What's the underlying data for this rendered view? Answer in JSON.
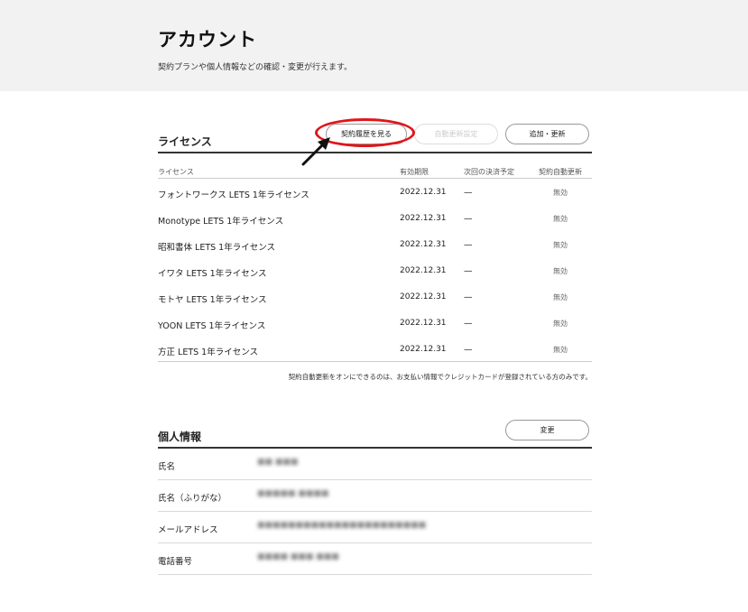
{
  "header": {
    "title": "アカウント",
    "description": "契約プランや個人情報などの確認・変更が行えます。"
  },
  "license_section": {
    "title": "ライセンス",
    "buttons": {
      "history": "契約履歴を見る",
      "auto_renew": "自動更新設定",
      "add_update": "追加・更新"
    },
    "columns": {
      "license": "ライセンス",
      "expiry": "有効期限",
      "next_payment": "次回の決済予定",
      "auto_renew": "契約自動更新"
    },
    "rows": [
      {
        "name": "フォントワークス LETS 1年ライセンス",
        "expiry": "2022.12.31",
        "next": "—",
        "auto": "無効"
      },
      {
        "name": "Monotype LETS 1年ライセンス",
        "expiry": "2022.12.31",
        "next": "—",
        "auto": "無効"
      },
      {
        "name": "昭和書体 LETS 1年ライセンス",
        "expiry": "2022.12.31",
        "next": "—",
        "auto": "無効"
      },
      {
        "name": "イワタ LETS 1年ライセンス",
        "expiry": "2022.12.31",
        "next": "—",
        "auto": "無効"
      },
      {
        "name": "モトヤ LETS 1年ライセンス",
        "expiry": "2022.12.31",
        "next": "—",
        "auto": "無効"
      },
      {
        "name": "YOON LETS 1年ライセンス",
        "expiry": "2022.12.31",
        "next": "—",
        "auto": "無効"
      },
      {
        "name": "方正 LETS 1年ライセンス",
        "expiry": "2022.12.31",
        "next": "—",
        "auto": "無効"
      }
    ],
    "note": "契約自動更新をオンにできるのは、お支払い情報でクレジットカードが登録されている方のみです。"
  },
  "personal_section": {
    "title": "個人情報",
    "change_button": "変更",
    "rows": [
      {
        "label": "氏名",
        "value": "■■ ■■■"
      },
      {
        "label": "氏名（ふりがな）",
        "value": "■■■■■ ■■■■"
      },
      {
        "label": "メールアドレス",
        "value": "■■■■■■■■■■■■■■■■■■■■■■"
      },
      {
        "label": "電話番号",
        "value": "■■■■ ■■■ ■■■"
      }
    ]
  },
  "annotation": {
    "circle_color": "#e0161b",
    "arrow_color": "#111111"
  }
}
